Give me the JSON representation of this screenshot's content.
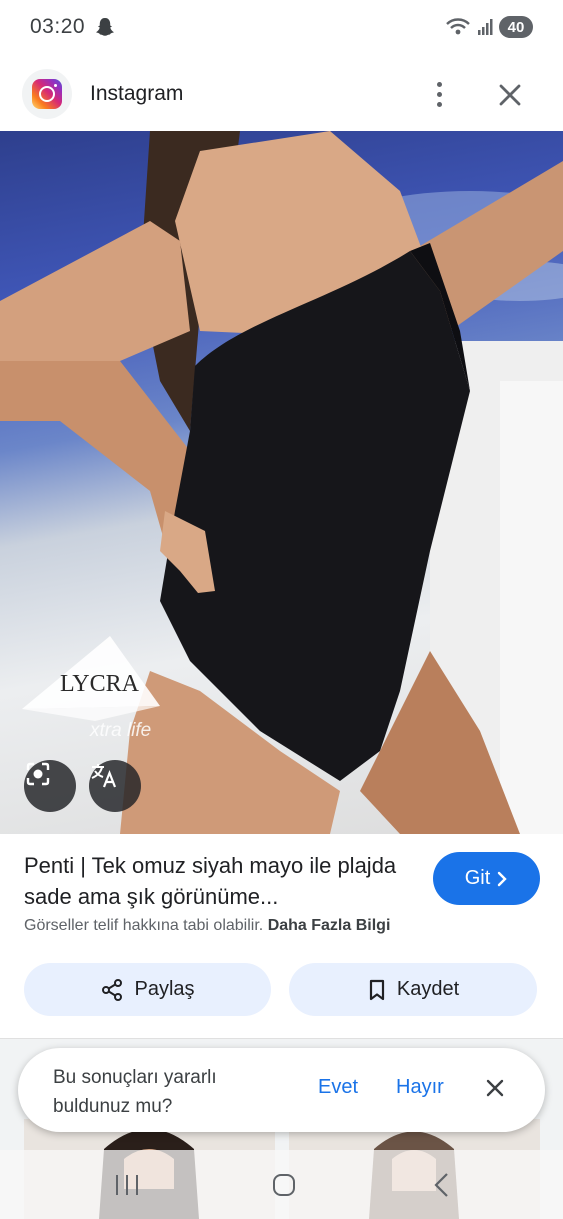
{
  "status_bar": {
    "time": "03:20",
    "battery": "40"
  },
  "header": {
    "title": "Instagram"
  },
  "image": {
    "watermark_brand": "LYCRA",
    "watermark_sub": "xtra life"
  },
  "result": {
    "title": "Penti | Tek omuz siyah mayo ile plajda sade ama şık görünüme...",
    "copyright_note": "Görseller telif hakkına tabi olabilir.",
    "more_info_label": "Daha Fazla Bilgi",
    "go_label": "Git"
  },
  "actions": {
    "share_label": "Paylaş",
    "save_label": "Kaydet"
  },
  "feedback": {
    "question": "Bu sonuçları yararlı buldunuz mu?",
    "yes_label": "Evet",
    "no_label": "Hayır"
  },
  "colors": {
    "accent": "#1a73e8",
    "pill_bg": "#e8f0fe"
  }
}
